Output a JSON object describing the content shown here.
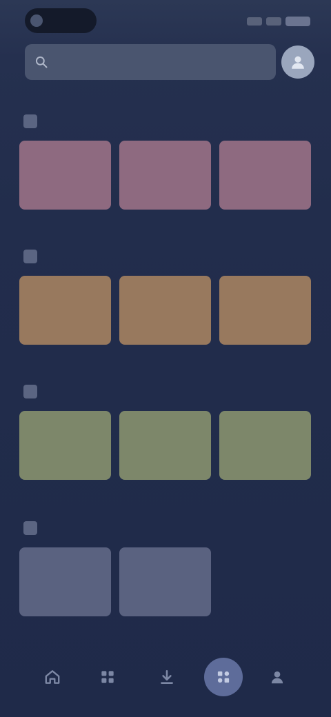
{
  "status_bar": {
    "time": "",
    "icons": [
      "signal-icon",
      "wifi-icon",
      "battery-icon"
    ]
  },
  "search": {
    "placeholder": "",
    "value": ""
  },
  "sections": [
    {
      "title": "",
      "color": "#8e6a80",
      "tiles": [
        "",
        "",
        ""
      ]
    },
    {
      "title": "",
      "color": "#98795e",
      "tiles": [
        "",
        "",
        ""
      ]
    },
    {
      "title": "",
      "color": "#7d876a",
      "tiles": [
        "",
        "",
        ""
      ]
    },
    {
      "title": "",
      "color": "#5a6280",
      "tiles": [
        "",
        ""
      ]
    }
  ],
  "bottom_nav": {
    "items": [
      {
        "icon": "home-icon"
      },
      {
        "icon": "grid-icon"
      },
      {
        "icon": "download-icon"
      },
      {
        "icon": "category-icon",
        "active": true
      },
      {
        "icon": "profile-icon"
      }
    ]
  },
  "colors": {
    "background": "#1f2a48",
    "search_bg": "#4a556f",
    "active_nav": "#5e6c9a"
  }
}
